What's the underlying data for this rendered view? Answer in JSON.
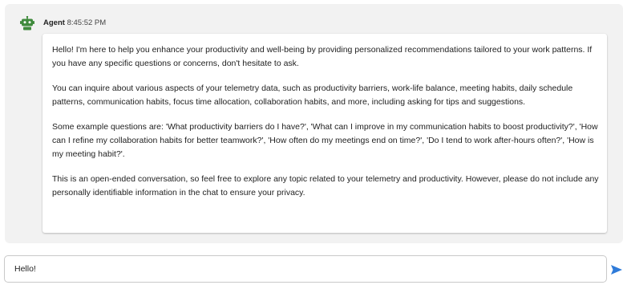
{
  "message": {
    "sender": "Agent",
    "time": "8:45:52 PM",
    "paragraphs": [
      "Hello! I'm here to help you enhance your productivity and well-being by providing personalized recommendations tailored to your work patterns. If you have any specific questions or concerns, don't hesitate to ask.",
      "You can inquire about various aspects of your telemetry data, such as productivity barriers, work-life balance, meeting habits, daily schedule patterns, communication habits, focus time allocation, collaboration habits, and more, including asking for tips and suggestions.",
      "Some example questions are: 'What productivity barriers do I have?', 'What can I improve in my communication habits to boost productivity?', 'How can I refine my collaboration habits for better teamwork?', 'How often do my meetings end on time?', 'Do I tend to work after-hours often?', 'How is my meeting habit?'.",
      "This is an open-ended conversation, so feel free to explore any topic related to your telemetry and productivity. However, please do not include any personally identifiable information in the chat to ensure your privacy."
    ]
  },
  "composer": {
    "value": "Hello!"
  },
  "icons": {
    "avatar": "robot-icon",
    "send": "send-icon"
  },
  "colors": {
    "avatar": "#3f8a3c",
    "send": "#2f7bd9",
    "panel": "#f2f2f2"
  }
}
